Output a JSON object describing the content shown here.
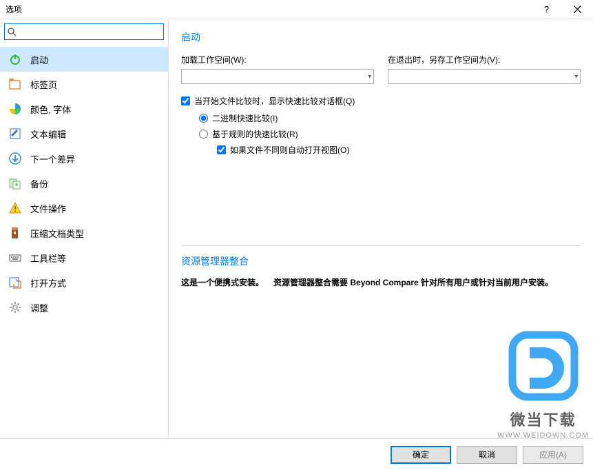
{
  "title": "选项",
  "search": {
    "placeholder": ""
  },
  "nav": {
    "items": [
      {
        "label": "启动"
      },
      {
        "label": "标签页"
      },
      {
        "label": "颜色, 字体"
      },
      {
        "label": "文本编辑"
      },
      {
        "label": "下一个差异"
      },
      {
        "label": "备份"
      },
      {
        "label": "文件操作"
      },
      {
        "label": "压缩文档类型"
      },
      {
        "label": "工具栏等"
      },
      {
        "label": "打开方式"
      },
      {
        "label": "调整"
      }
    ]
  },
  "content": {
    "section_title": "启动",
    "load_workspace_label": "加载工作空间(W):",
    "save_workspace_label": "在退出时，另存工作空间为(V):",
    "checkbox_dialog": "当开始文件比较时，显示快速比较对话框(Q)",
    "radio_binary": "二进制快速比较(I)",
    "radio_rules": "基于规则的快速比较(R)",
    "checkbox_openview": "如果文件不同则自动打开视图(O)",
    "explorer_title": "资源管理器整合",
    "explorer_text1": "这是一个便携式安装。",
    "explorer_text2": "资源管理器整合需要 Beyond Compare 针对所有用户或针对当前用户安装。"
  },
  "footer": {
    "ok": "确定",
    "cancel": "取消",
    "apply": "应用(A)"
  },
  "watermark": {
    "text1": "微当下载",
    "text2": "WWW.WEIDOWN.COM"
  }
}
